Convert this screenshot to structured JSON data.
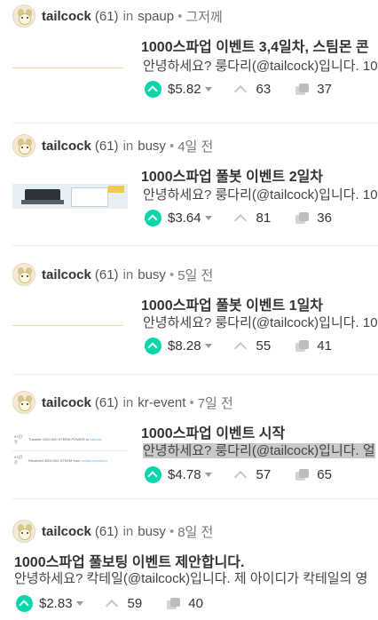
{
  "posts": [
    {
      "author": "tailcock",
      "reputation": "(61)",
      "in_label": "in",
      "category": "spaup",
      "separator": "•",
      "time": "그저께",
      "title": "1000스파업 이벤트 3,4일차, 스팀몬 콘",
      "excerpt": "안녕하세요? 룽다리(@tailcock)입니다. 10",
      "payout": "$5.82",
      "likes": "63",
      "comments": "37"
    },
    {
      "author": "tailcock",
      "reputation": "(61)",
      "in_label": "in",
      "category": "busy",
      "separator": "•",
      "time": "4일 전",
      "title": "1000스파업 풀봇 이벤트 2일차",
      "excerpt": "안녕하세요? 룽다리(@tailcock)입니다. 10",
      "payout": "$3.64",
      "likes": "81",
      "comments": "36"
    },
    {
      "author": "tailcock",
      "reputation": "(61)",
      "in_label": "in",
      "category": "busy",
      "separator": "•",
      "time": "5일 전",
      "title": "1000스파업 풀봇 이벤트 1일차",
      "excerpt": "안녕하세요? 룽다리(@tailcock)입니다. 10",
      "payout": "$8.28",
      "likes": "55",
      "comments": "41"
    },
    {
      "author": "tailcock",
      "reputation": "(61)",
      "in_label": "in",
      "category": "kr-event",
      "separator": "•",
      "time": "7일 전",
      "title": "1000스파업 이벤트 시작",
      "excerpt": "안녕하세요? 룽다리(@tailcock)입니다. 얼",
      "payout": "$4.78",
      "likes": "57",
      "comments": "65",
      "thumb_rows": [
        {
          "label": "9시간 전",
          "text": "Transfer 1000.000 STEEM POWER to ",
          "link": "tailcock"
        },
        {
          "label": "9시간 전",
          "text": "Received 3000.000 STEEM from ",
          "link": "quilabounceitout"
        }
      ]
    },
    {
      "author": "tailcock",
      "reputation": "(61)",
      "in_label": "in",
      "category": "busy",
      "separator": "•",
      "time": "8일 전",
      "title": "1000스파업 풀보팅 이벤트 제안합니다.",
      "excerpt": "안녕하세요? 칵테일(@tailcock)입니다. 제 아이디가 칵테일의 영",
      "payout": "$2.83",
      "likes": "59",
      "comments": "40"
    }
  ],
  "colors": {
    "vote_accent": "#06d6a9",
    "excerpt_highlight": "#c9c9c9"
  }
}
